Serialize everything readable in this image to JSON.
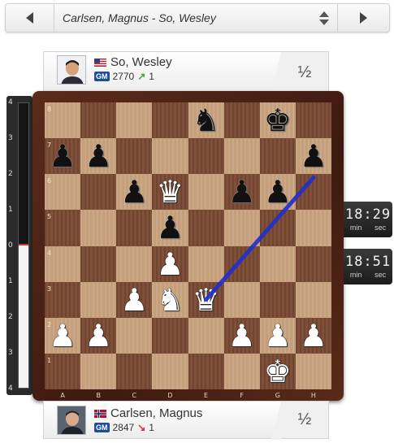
{
  "game_selector": {
    "title": "Carlsen, Magnus - So, Wesley"
  },
  "top_player": {
    "name": "So, Wesley",
    "title_badge": "GM",
    "rating": "2770",
    "rating_change": "1",
    "trend": "up",
    "score": "½",
    "flag": "USA"
  },
  "bottom_player": {
    "name": "Carlsen, Magnus",
    "title_badge": "GM",
    "rating": "2847",
    "rating_change": "1",
    "trend": "down",
    "score": "½",
    "flag": "Norway"
  },
  "clocks": {
    "top": {
      "hours": "18",
      "minutes": "29",
      "min_label": "min",
      "sec_label": "sec"
    },
    "bottom": {
      "hours": "18",
      "minutes": "51",
      "min_label": "min",
      "sec_label": "sec"
    }
  },
  "eval_bar": {
    "ticks": [
      "4",
      "3",
      "2",
      "1",
      "0",
      "1",
      "2",
      "3",
      "4"
    ],
    "white_fraction": 0.5
  },
  "board": {
    "files": [
      "A",
      "B",
      "C",
      "D",
      "E",
      "F",
      "G",
      "H"
    ],
    "ranks": [
      "8",
      "7",
      "6",
      "5",
      "4",
      "3",
      "2",
      "1"
    ],
    "pieces": [
      {
        "square": "e8",
        "piece": "knight",
        "color": "black"
      },
      {
        "square": "g8",
        "piece": "king",
        "color": "black"
      },
      {
        "square": "a7",
        "piece": "pawn",
        "color": "black"
      },
      {
        "square": "b7",
        "piece": "pawn",
        "color": "black"
      },
      {
        "square": "h7",
        "piece": "pawn",
        "color": "black"
      },
      {
        "square": "c6",
        "piece": "pawn",
        "color": "black"
      },
      {
        "square": "d6",
        "piece": "queen",
        "color": "white"
      },
      {
        "square": "f6",
        "piece": "pawn",
        "color": "black"
      },
      {
        "square": "g6",
        "piece": "pawn",
        "color": "black"
      },
      {
        "square": "d5",
        "piece": "pawn",
        "color": "black"
      },
      {
        "square": "d4",
        "piece": "pawn",
        "color": "white"
      },
      {
        "square": "c3",
        "piece": "pawn",
        "color": "white"
      },
      {
        "square": "d3",
        "piece": "knight",
        "color": "white"
      },
      {
        "square": "e3",
        "piece": "queen",
        "color": "white"
      },
      {
        "square": "a2",
        "piece": "pawn",
        "color": "white"
      },
      {
        "square": "b2",
        "piece": "pawn",
        "color": "white"
      },
      {
        "square": "f2",
        "piece": "pawn",
        "color": "white"
      },
      {
        "square": "g2",
        "piece": "pawn",
        "color": "white"
      },
      {
        "square": "h2",
        "piece": "pawn",
        "color": "white"
      },
      {
        "square": "g1",
        "piece": "king",
        "color": "white"
      }
    ],
    "arrow": {
      "from": "h6",
      "to": "e3",
      "color": "#1f2fd0"
    }
  }
}
